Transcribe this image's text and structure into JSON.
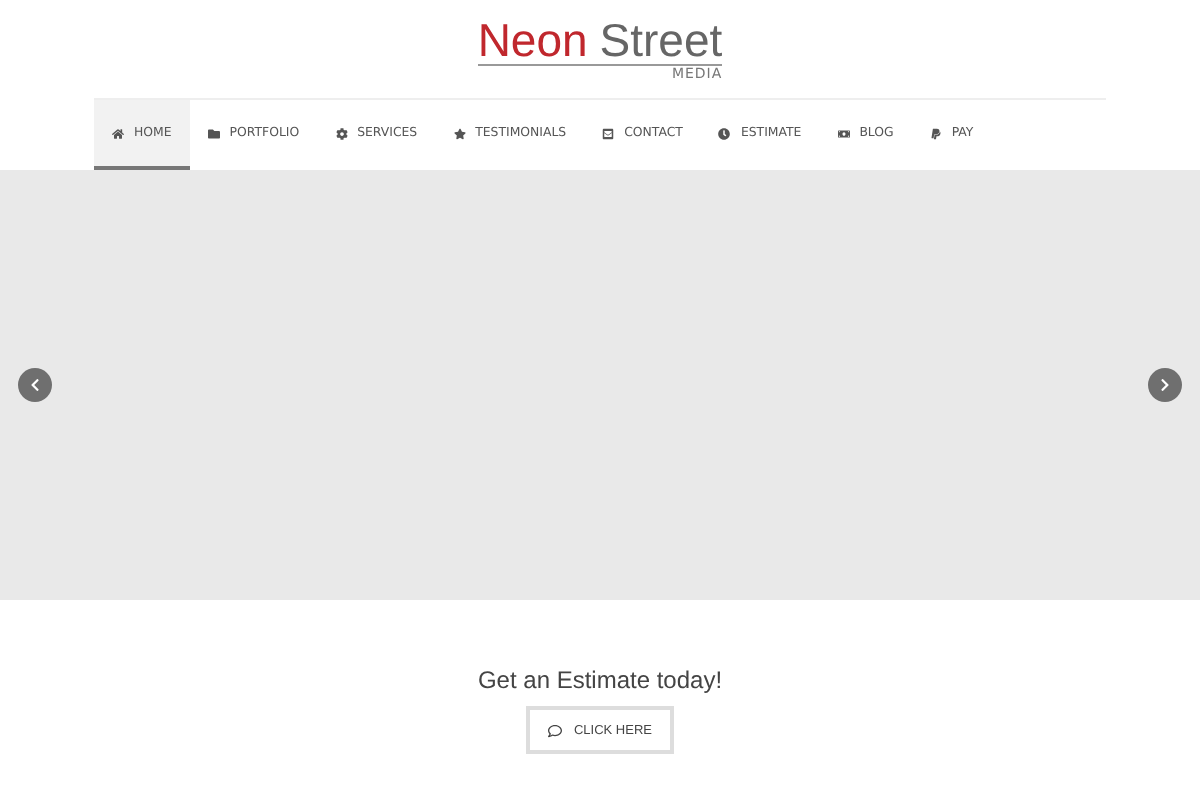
{
  "logo": {
    "first": "Neon",
    "second": "Street",
    "tagline": "MEDIA"
  },
  "nav": [
    {
      "label": "HOME",
      "selected": true
    },
    {
      "label": "PORTFOLIO",
      "selected": false
    },
    {
      "label": "SERVICES",
      "selected": false
    },
    {
      "label": "TESTIMONIALS",
      "selected": false
    },
    {
      "label": "CONTACT",
      "selected": false
    },
    {
      "label": "ESTIMATE",
      "selected": false
    },
    {
      "label": "BLOG",
      "selected": false
    },
    {
      "label": "PAY",
      "selected": false
    }
  ],
  "cta": {
    "heading": "Get an Estimate today!",
    "button": "CLICK HERE"
  }
}
